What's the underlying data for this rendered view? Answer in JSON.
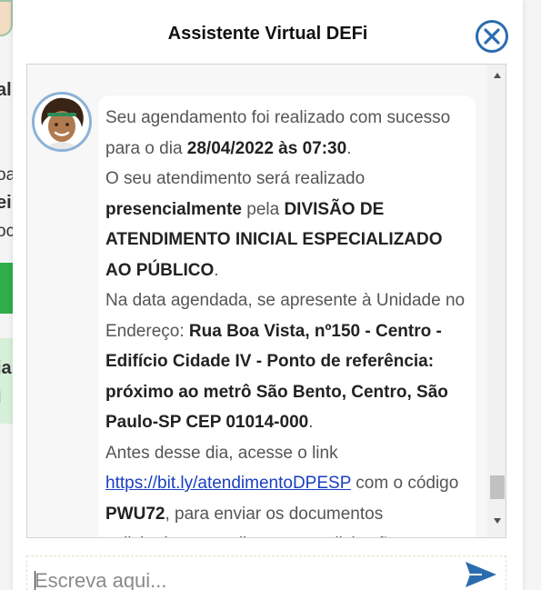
{
  "background_page": {
    "fragments": [
      "al",
      "oa",
      "ei",
      "oc",
      "ia",
      "i"
    ]
  },
  "chat": {
    "title": "Assistente Virtual DEFi",
    "message": {
      "p1_a": "Seu agendamento foi realizado com sucesso para o dia ",
      "p1_date": "28/04/2022 às 07:30",
      "p1_end": ".",
      "p2_a": "O seu atendimento será realizado ",
      "p2_mode": "presencialmente",
      "p2_b": " pela ",
      "p2_division": "DIVISÃO DE ATENDIMENTO INICIAL ESPECIALIZADO AO PÚBLICO",
      "p2_end": ".",
      "p3_a": "Na data agendada, se apresente à Unidade no Endereço: ",
      "p3_address": "Rua Boa Vista, nº150 - Centro - Edifício Cidade IV - Ponto de referência: próximo ao metrô São Bento, Centro, São Paulo-SP CEP 01014-000",
      "p3_end": ".",
      "p4_a": "Antes desse dia, acesse o link ",
      "p4_link": "https://bit.ly/atendimentoDPESP",
      "p4_b": " com o código ",
      "p4_code": "PWU72",
      "p4_c": ", para enviar os documentos solicitados e atualizar suas solicitações."
    },
    "input": {
      "placeholder": "Escreva aqui..."
    },
    "colors": {
      "accent": "#2b6cb0",
      "link": "#1a3fbf",
      "avatar_border": "#8cb2d6"
    },
    "icons": {
      "close": "close-icon",
      "send": "send-icon",
      "scroll_up": "scroll-up-icon",
      "scroll_down": "scroll-down-icon"
    }
  }
}
